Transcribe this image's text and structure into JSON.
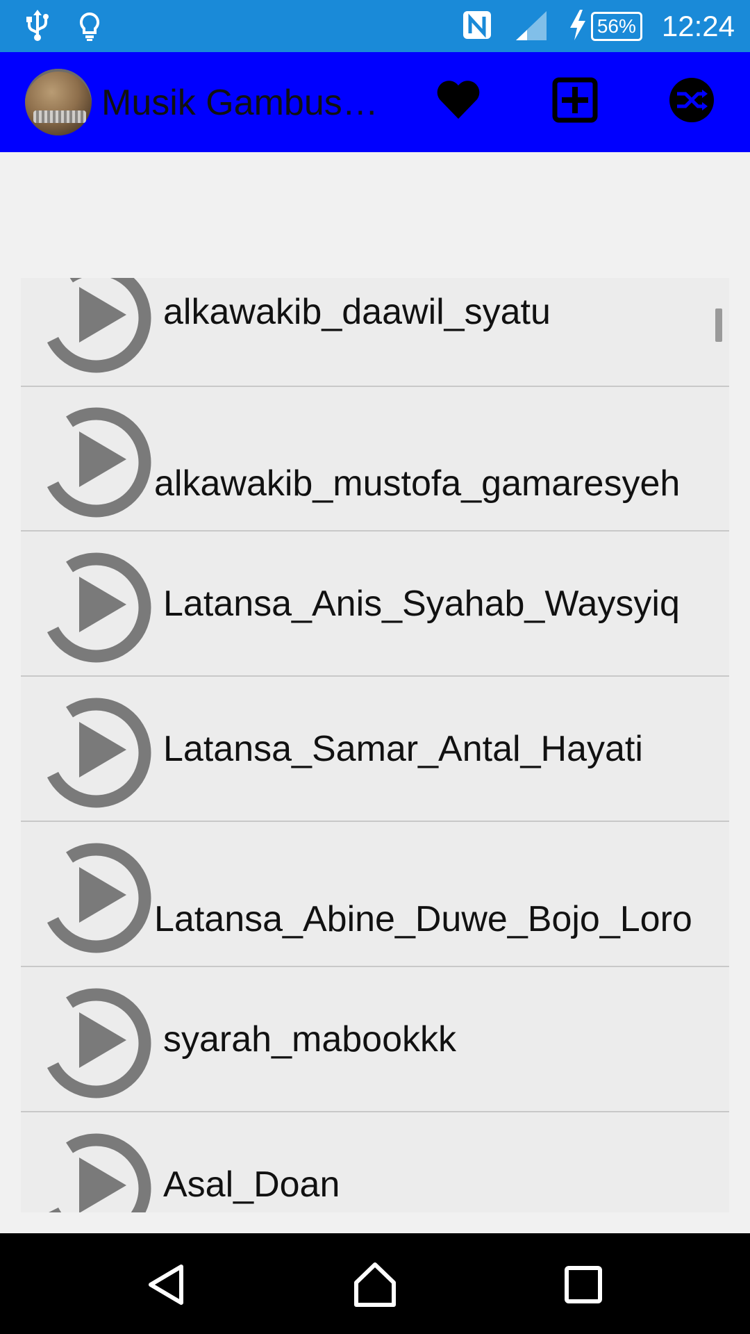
{
  "status_bar": {
    "time": "12:24",
    "battery_percent": "56%",
    "icons": [
      "usb-icon",
      "bulb-icon",
      "nfc-icon",
      "signal-icon",
      "charging-icon",
      "battery-icon"
    ]
  },
  "app_bar": {
    "title": "Musik Gambus…",
    "actions": [
      "heart-icon",
      "add-box-icon",
      "shuffle-icon"
    ]
  },
  "songs": [
    "alkawakib_daawil_syatu",
    "alkawakib_mustofa_gamaresyeh",
    "Latansa_Anis_Syahab_Waysyiq",
    "Latansa_Samar_Antal_Hayati",
    "Latansa_Abine_Duwe_Bojo_Loro",
    "syarah_mabookkk",
    "Asal_Doan"
  ],
  "nav": [
    "back-icon",
    "home-icon",
    "recents-icon"
  ],
  "colors": {
    "status_bar": "#1a8ad8",
    "app_bar": "#0000ff",
    "list_bg": "#ececec",
    "icon_gray": "#7a7a7a"
  }
}
